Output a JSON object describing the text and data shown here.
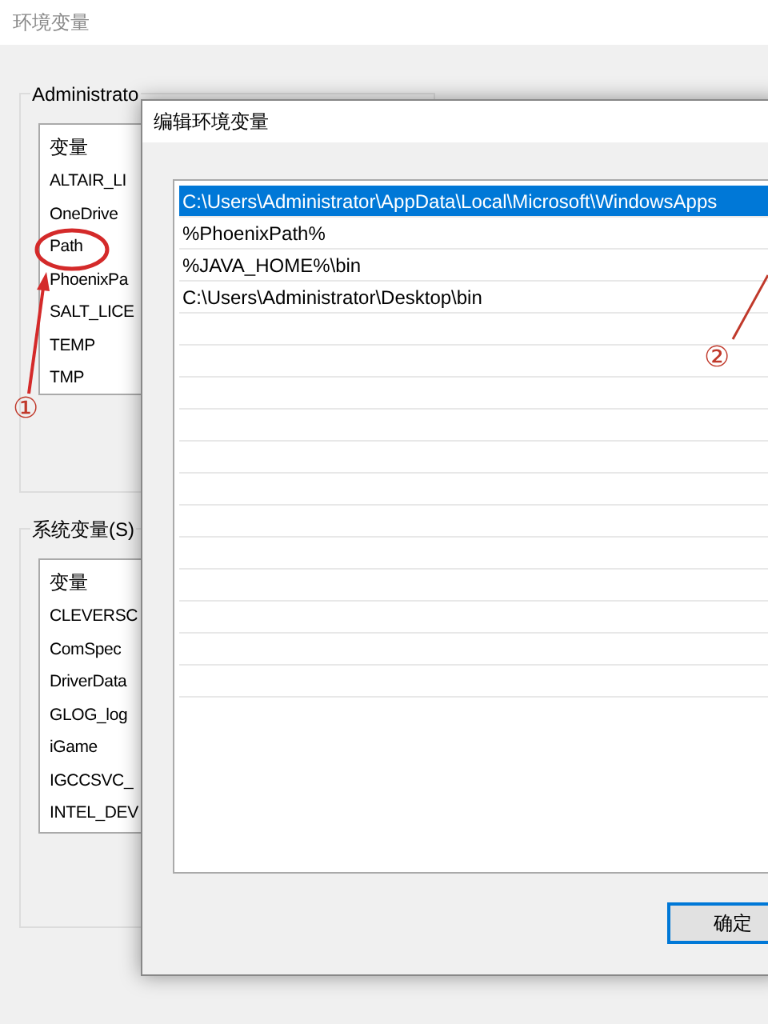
{
  "background_window": {
    "title": "环境变量",
    "user_group_label": "Administrato",
    "user_list": {
      "header": "变量",
      "rows": [
        "ALTAIR_LI",
        "OneDrive",
        "Path",
        "PhoenixPa",
        "SALT_LICE",
        "TEMP",
        "TMP"
      ]
    },
    "system_group_label": "系统变量(S)",
    "system_list": {
      "header": "变量",
      "rows": [
        "CLEVERSC",
        "ComSpec",
        "DriverData",
        "GLOG_log",
        "iGame",
        "IGCCSVC_",
        "INTEL_DEV"
      ]
    }
  },
  "dialog": {
    "title": "编辑环境变量",
    "paths": [
      {
        "text": "C:\\Users\\Administrator\\AppData\\Local\\Microsoft\\WindowsApps",
        "selected": true
      },
      {
        "text": "%PhoenixPath%",
        "selected": false
      },
      {
        "text": "%JAVA_HOME%\\bin",
        "selected": false
      },
      {
        "text": "C:\\Users\\Administrator\\Desktop\\bin",
        "selected": false
      }
    ],
    "ok_button": "确定"
  },
  "annotations": [
    {
      "label": "①"
    },
    {
      "label": "②"
    }
  ]
}
